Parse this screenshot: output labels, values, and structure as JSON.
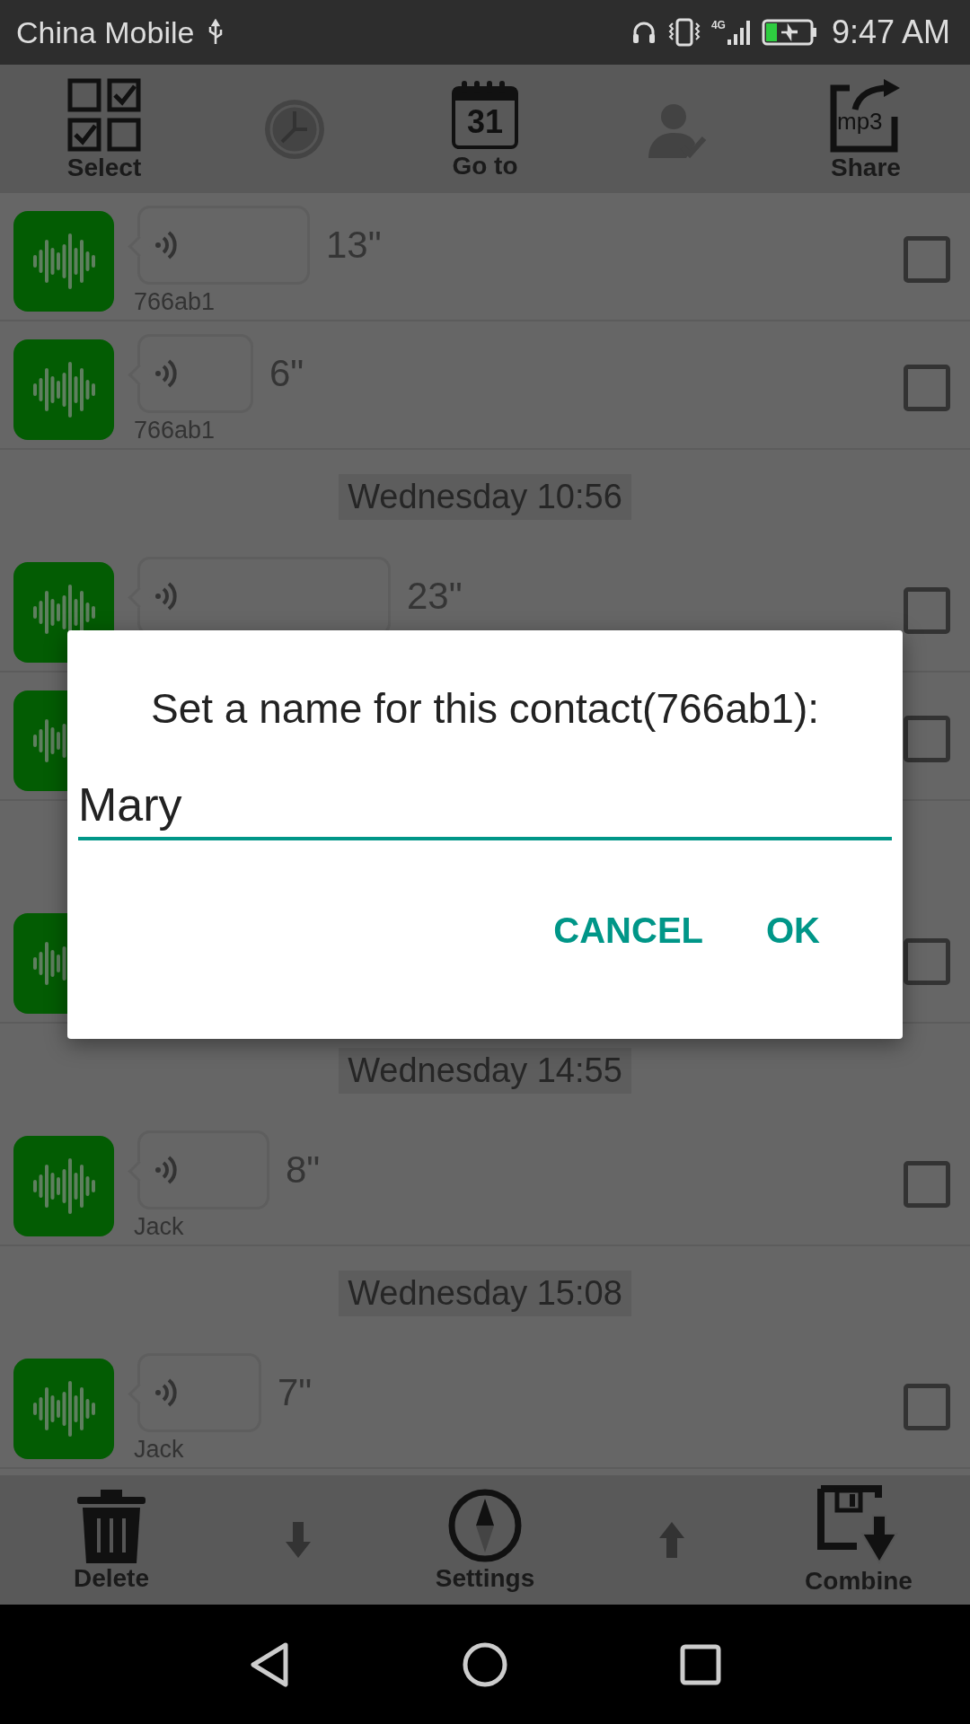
{
  "status_bar": {
    "carrier": "China Mobile",
    "network": "4G",
    "time": "9:47 AM"
  },
  "toolbar": [
    {
      "kind": "select",
      "label": "Select",
      "disabled": false
    },
    {
      "kind": "clock",
      "disabled": false
    },
    {
      "kind": "calendar",
      "icon_text": "31",
      "label": "Go to",
      "disabled": false
    },
    {
      "kind": "person",
      "disabled": true
    },
    {
      "kind": "share",
      "icon_text": "mp3",
      "label": "Share",
      "disabled": false
    }
  ],
  "list": [
    {
      "kind": "recording",
      "duration": "13\"",
      "contact": "766ab1",
      "checked": false
    },
    {
      "kind": "recording",
      "duration": "6\"",
      "contact": "766ab1",
      "checked": false
    },
    {
      "kind": "date",
      "label": "Wednesday 10:56"
    },
    {
      "kind": "recording",
      "duration": "23\"",
      "checked": false
    },
    {
      "kind": "recording",
      "checked": false
    },
    {
      "kind": "date"
    },
    {
      "kind": "recording",
      "checked": false
    },
    {
      "kind": "date",
      "label": "Wednesday 14:55"
    },
    {
      "kind": "recording",
      "duration": "8\"",
      "contact": "Jack",
      "checked": false
    },
    {
      "kind": "date",
      "label": "Wednesday 15:08"
    },
    {
      "kind": "recording",
      "duration": "7\"",
      "contact": "Jack",
      "checked": false
    }
  ],
  "dialog": {
    "title": "Set a name for this contact(766ab1):",
    "value": "Mary",
    "buttons": [
      "CANCEL",
      "OK"
    ]
  },
  "bottom_bar": [
    {
      "kind": "trash",
      "label": "Delete"
    },
    {
      "kind": "down"
    },
    {
      "kind": "compass",
      "label": "Settings"
    },
    {
      "kind": "up"
    },
    {
      "kind": "floppy",
      "label": "Combine"
    }
  ]
}
